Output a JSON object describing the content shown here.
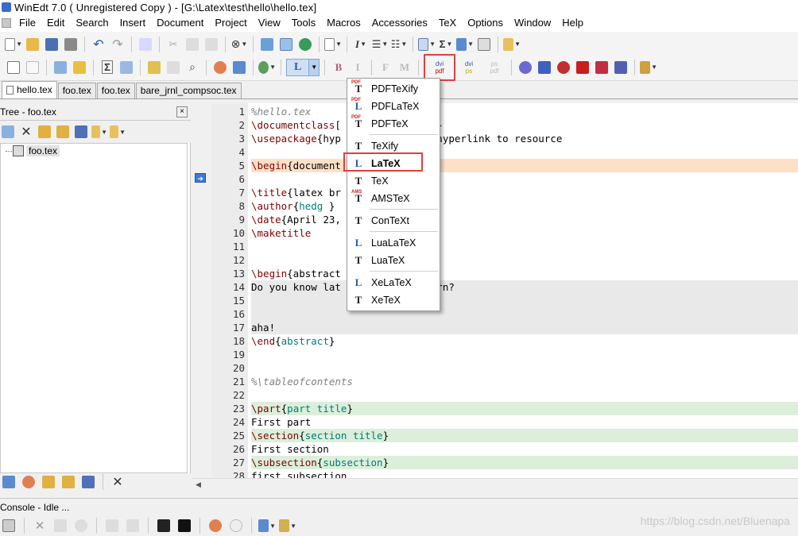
{
  "window": {
    "title": "WinEdt 7.0  ( Unregistered  Copy )  - [G:\\Latex\\test\\hello\\hello.tex]"
  },
  "menubar": [
    "File",
    "Edit",
    "Search",
    "Insert",
    "Document",
    "Project",
    "View",
    "Tools",
    "Macros",
    "Accessories",
    "TeX",
    "Options",
    "Window",
    "Help"
  ],
  "toolbar2": {
    "latex_selector_label": "L",
    "bold_label": "B",
    "italic_label": "I",
    "f_label": "F",
    "m_label": "M",
    "dvi_pdf_top": "dvi",
    "dvi_pdf_bottom": "pdf",
    "dvi_ps_top": "dvi",
    "dvi_ps_bottom": "ps",
    "ps_pdf_top": "ps",
    "ps_pdf_bottom": "pdf",
    "sigma_label": "Σ"
  },
  "tabs": [
    "hello.tex",
    "foo.tex",
    "foo.tex",
    "bare_jrnl_compsoc.tex"
  ],
  "tree": {
    "title": "Tree - foo.tex",
    "close_label": "×",
    "node": "foo.tex"
  },
  "editor": {
    "lines": [
      {
        "n": "1",
        "text": "%hello.tex"
      },
      {
        "n": "2",
        "text": "\\documentclass[              le}"
      },
      {
        "n": "3",
        "text": "\\usepackage{hyp              e hyperlink to resource"
      },
      {
        "n": "4",
        "text": ""
      },
      {
        "n": "5",
        "text": "\\begin{document"
      },
      {
        "n": "6",
        "text": ""
      },
      {
        "n": "7",
        "text": "\\title{latex br"
      },
      {
        "n": "8",
        "text": "\\author{hedg }"
      },
      {
        "n": "9",
        "text": "\\date{April 23,"
      },
      {
        "n": "10",
        "text": "\\maketitle"
      },
      {
        "n": "11",
        "text": ""
      },
      {
        "n": "12",
        "text": ""
      },
      {
        "n": "13",
        "text": "\\begin{abstract"
      },
      {
        "n": "14",
        "text": "Do you know lat              earn?"
      },
      {
        "n": "15",
        "text": ""
      },
      {
        "n": "16",
        "text": ""
      },
      {
        "n": "17",
        "text": "aha!"
      },
      {
        "n": "18",
        "text": "\\end{abstract}"
      },
      {
        "n": "19",
        "text": ""
      },
      {
        "n": "20",
        "text": ""
      },
      {
        "n": "21",
        "text": "%\\tableofcontents"
      },
      {
        "n": "22",
        "text": ""
      },
      {
        "n": "23",
        "text": "\\part{part title}"
      },
      {
        "n": "24",
        "text": "First part"
      },
      {
        "n": "25",
        "text": "\\section{section title}"
      },
      {
        "n": "26",
        "text": "First section"
      },
      {
        "n": "27",
        "text": "\\subsection{subsection}"
      },
      {
        "n": "28",
        "text": "first subsection"
      }
    ]
  },
  "compile_menu": {
    "items": [
      {
        "label": "PDFTeXify",
        "icon": "pdftexify-icon",
        "glyph": "T",
        "badge": "PDF"
      },
      {
        "label": "PDFLaTeX",
        "icon": "pdflatex-icon",
        "glyph": "L",
        "badge": "PDF"
      },
      {
        "label": "PDFTeX",
        "icon": "pdftex-icon",
        "glyph": "T",
        "badge": "PDF"
      },
      {
        "label": "TeXify",
        "icon": "texify-icon",
        "glyph": "T",
        "badge": ""
      },
      {
        "label": "LaTeX",
        "icon": "latex-icon",
        "glyph": "L",
        "badge": ""
      },
      {
        "label": "TeX",
        "icon": "tex-icon",
        "glyph": "T",
        "badge": ""
      },
      {
        "label": "AMSTeX",
        "icon": "amstex-icon",
        "glyph": "T",
        "badge": "AMS"
      },
      {
        "label": "ConTeXt",
        "icon": "context-icon",
        "glyph": "T",
        "badge": ""
      },
      {
        "label": "LuaLaTeX",
        "icon": "lualatex-icon",
        "glyph": "L",
        "badge": ""
      },
      {
        "label": "LuaTeX",
        "icon": "luatex-icon",
        "glyph": "T",
        "badge": ""
      },
      {
        "label": "XeLaTeX",
        "icon": "xelatex-icon",
        "glyph": "L",
        "badge": ""
      },
      {
        "label": "XeTeX",
        "icon": "xetex-icon",
        "glyph": "T",
        "badge": ""
      }
    ],
    "selected": "LaTeX"
  },
  "console": {
    "status": "Console - Idle ..."
  },
  "watermark": "https://blog.csdn.net/Bluenapa",
  "colors": {
    "accent": "#3b7bd6",
    "highlight_box": "#e04040",
    "current_line": "#fde0c8",
    "section_line": "#dbefdb"
  }
}
